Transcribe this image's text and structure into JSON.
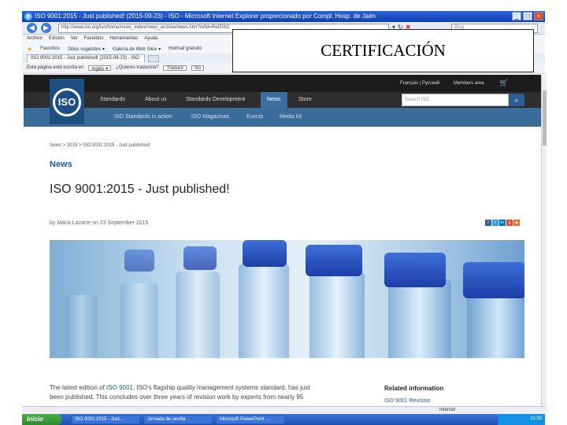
{
  "browser": {
    "title": "ISO 9001:2015 - Just published! (2015-09-23) - ISO - Microsoft Internet Explorer proporcionado por Compl. Hosp. de Jaén",
    "address": "http://www.iso.org/iso/home/news_index/news_archive/news.htm?refid=Ref2002",
    "search_placeholder": "Bing",
    "menu": [
      "Archivo",
      "Edición",
      "Ver",
      "Favoritos",
      "Herramientas",
      "Ayuda"
    ],
    "favorites": [
      "Favoritos",
      "Sitios sugeridos ▾",
      "Galería de Web Slice ▾",
      "Hotmail gratuito"
    ],
    "tab_label": "ISO 9001:2015 - Just published! (2015-09-23) - ISO",
    "translate": {
      "prompt": "Esta página está escrita en",
      "language": "Inglés ▾",
      "question": "¿Quieres traducirla?",
      "button": "Traducir",
      "no": "No"
    },
    "status_zone": "Internet"
  },
  "site": {
    "langs": "Français | Русский",
    "members": "Members area",
    "logo": "ISO",
    "nav": [
      "Standards",
      "About us",
      "Standards Development",
      "News",
      "Store"
    ],
    "search_placeholder": "Search ISO",
    "subnav": [
      "ISO Standards in action",
      "ISO Magazines",
      "Events",
      "Media kit"
    ],
    "breadcrumb": "News  >  2015  >  ISO 9001:2015 - Just published!",
    "section": "News",
    "article_title": "ISO 9001:2015 - Just published!",
    "byline": "by Maria Lazarte on 23 September 2015",
    "body_prefix": "The latest edition of ",
    "body_link": "ISO 9001",
    "body_rest": ", ISO's flagship quality management systems standard, has just been published. This concludes over three years of revision work by experts from nearly 95",
    "related_heading": "Related information",
    "related_link": "ISO 9001 Revision"
  },
  "taskbar": {
    "start": "Inicio",
    "tasks": [
      "ISO 9001:2015 - Just...",
      "Jornada de sevilla",
      "Microsoft PowerPoint ..."
    ],
    "time": "11:33"
  },
  "overlay": {
    "label": "CERTIFICACIÓN"
  },
  "colors": {
    "iso_blue": "#1e4f82",
    "subnav_blue": "#3a6c9a",
    "news_heading": "#1f5a9a"
  }
}
